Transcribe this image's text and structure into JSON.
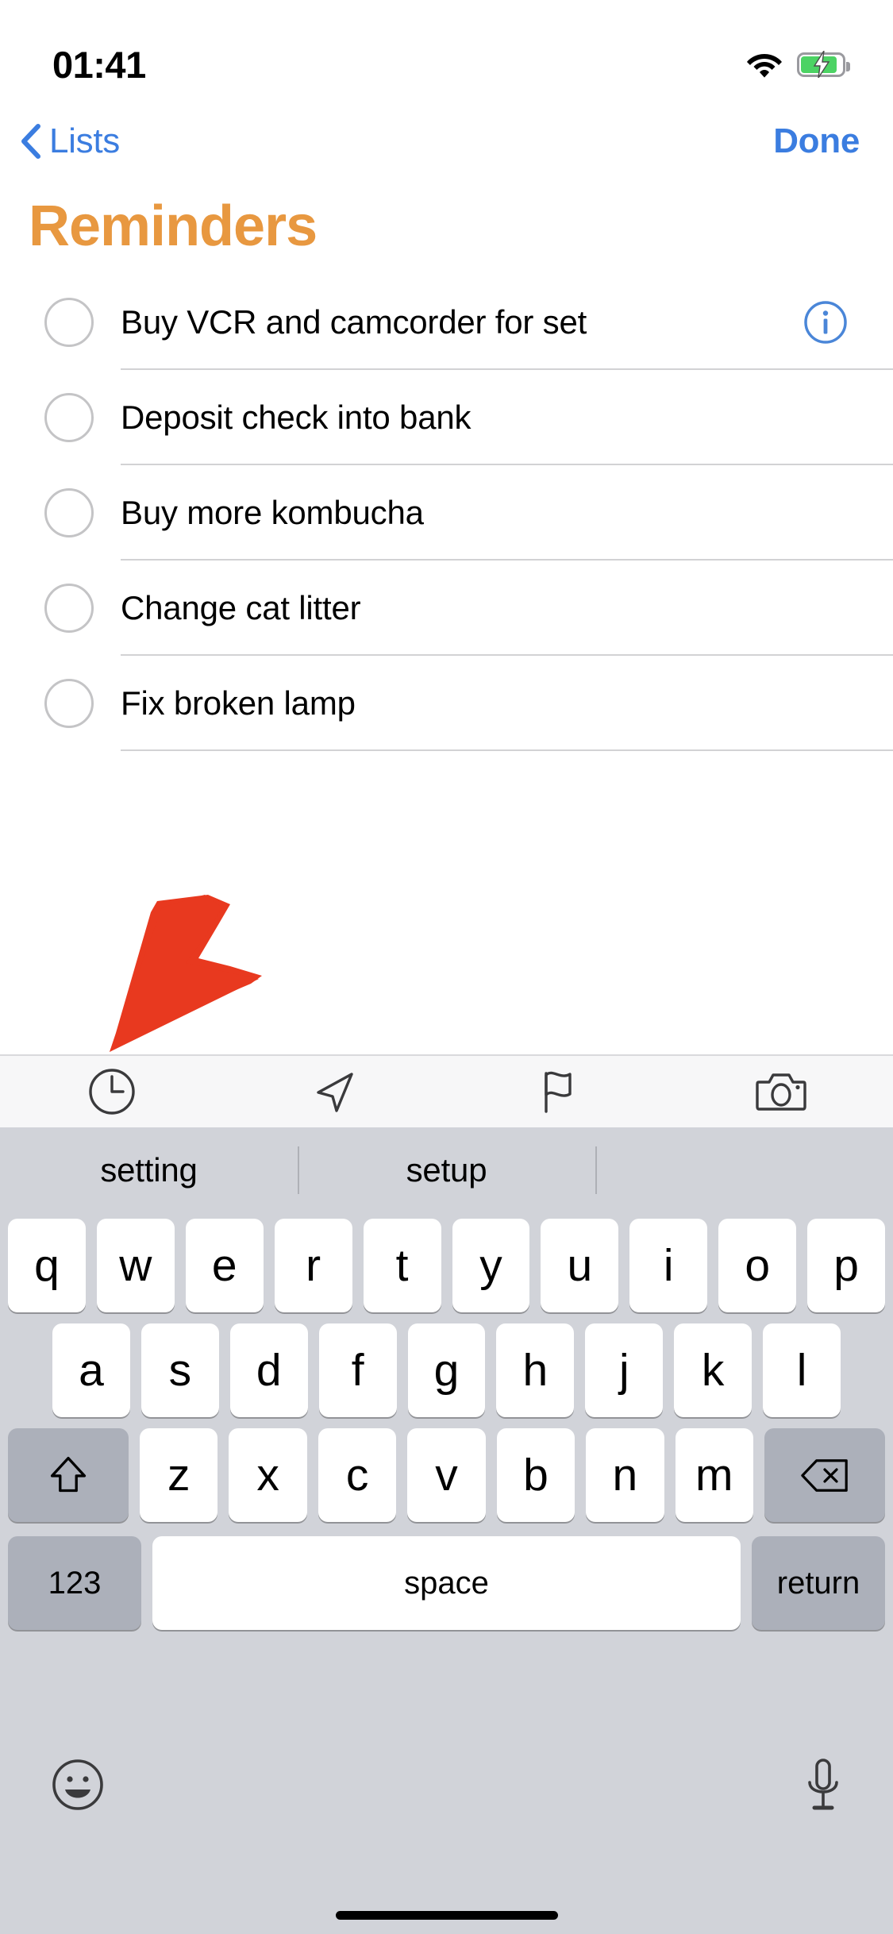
{
  "status_bar": {
    "time": "01:41",
    "wifi_icon": "wifi-icon",
    "battery_icon": "battery-charging-icon",
    "battery_color": "#4CD364",
    "charging": true
  },
  "nav_bar": {
    "back_icon": "chevron-left-icon",
    "back_label": "Lists",
    "done_label": "Done",
    "tint_color": "#3B7DE0"
  },
  "page_title": {
    "text": "Reminders",
    "color": "#E89840"
  },
  "reminders": [
    {
      "text": "Buy VCR and camcorder for set",
      "completed": false,
      "has_info": true
    },
    {
      "text": "Deposit check into bank",
      "completed": false,
      "has_info": false
    },
    {
      "text": "Buy more kombucha",
      "completed": false,
      "has_info": false
    },
    {
      "text": "Change cat litter",
      "completed": false,
      "has_info": false
    },
    {
      "text": "Fix broken lamp",
      "completed": false,
      "has_info": false
    }
  ],
  "annotation": {
    "type": "arrow",
    "color": "#E8391F",
    "points_to": "clock-icon"
  },
  "accessory_toolbar": {
    "buttons": [
      {
        "icon": "clock-icon",
        "label": "Remind me at a time"
      },
      {
        "icon": "location-arrow-icon",
        "label": "Remind me at a location"
      },
      {
        "icon": "flag-icon",
        "label": "Flag"
      },
      {
        "icon": "camera-icon",
        "label": "Add photo"
      }
    ]
  },
  "keyboard": {
    "suggestions": [
      "setting",
      "setup",
      ""
    ],
    "row1": [
      "q",
      "w",
      "e",
      "r",
      "t",
      "y",
      "u",
      "i",
      "o",
      "p"
    ],
    "row2": [
      "a",
      "s",
      "d",
      "f",
      "g",
      "h",
      "j",
      "k",
      "l"
    ],
    "row3": [
      "z",
      "x",
      "c",
      "v",
      "b",
      "n",
      "m"
    ],
    "shift_icon": "shift-up-arrow-icon",
    "delete_icon": "backspace-delete-icon",
    "numbers_label": "123",
    "space_label": "space",
    "return_label": "return",
    "emoji_icon": "emoji-smiley-icon",
    "dictation_icon": "microphone-icon"
  },
  "home_indicator": "home-indicator"
}
